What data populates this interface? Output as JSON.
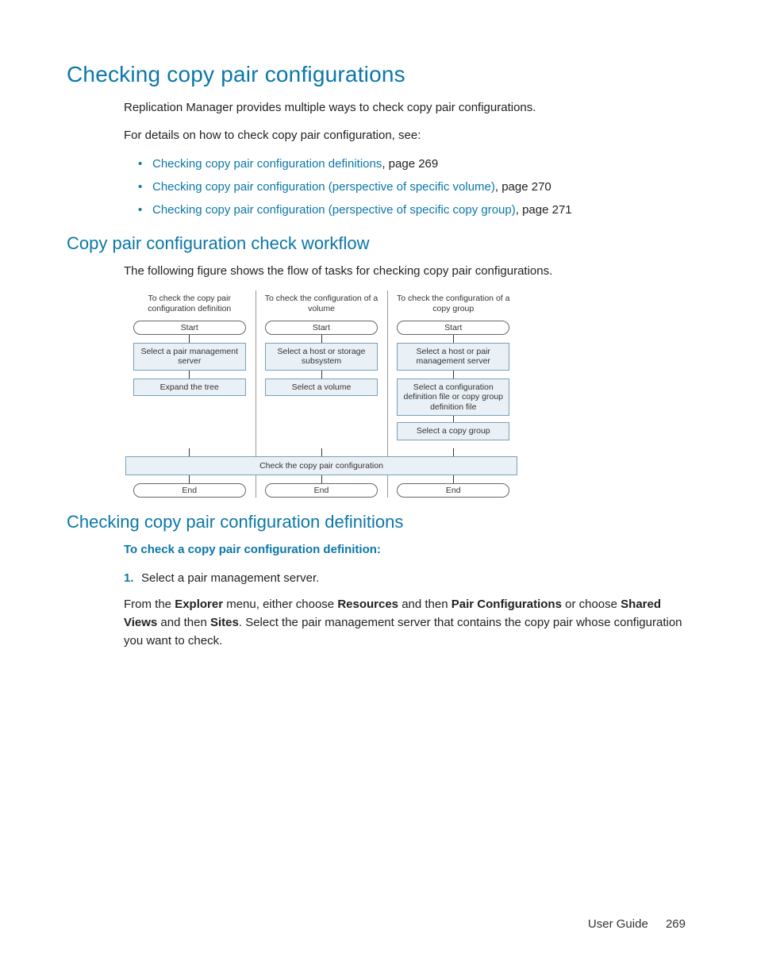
{
  "heading": "Checking copy pair configurations",
  "intro1": "Replication Manager provides multiple ways to check copy pair configurations.",
  "intro2": "For details on how to check copy pair configuration, see:",
  "bullets": [
    {
      "link": "Checking copy pair configuration definitions",
      "tail": ", page 269"
    },
    {
      "link": "Checking copy pair configuration (perspective of specific volume)",
      "tail": ", page 270"
    },
    {
      "link": "Checking copy pair configuration (perspective of specific copy group)",
      "tail": ", page 271"
    }
  ],
  "sub1": "Copy pair configuration check workflow",
  "sub1_text": "The following figure shows the flow of tasks for checking copy pair configurations.",
  "flow": {
    "col_heads": [
      "To check the copy pair configuration definition",
      "To check the configuration of a volume",
      "To check the configuration of a copy group"
    ],
    "start": "Start",
    "end": "End",
    "c1_step1": "Select a pair management server",
    "c1_step2": "Expand the tree",
    "c2_step1": "Select a host or storage subsystem",
    "c2_step2": "Select a volume",
    "c3_step1": "Select a host or pair management server",
    "c3_step2": "Select a configuration definition file or copy group definition file",
    "c3_step3": "Select a copy group",
    "merge": "Check the copy pair configuration"
  },
  "sub2": "Checking copy pair configuration definitions",
  "sub2_bold": "To check a copy pair configuration definition:",
  "step_num": "1.",
  "step1_text": "Select a pair management server.",
  "step1_cont_a": "From the ",
  "step1_cont_b": "Explorer",
  "step1_cont_c": " menu, either choose ",
  "step1_cont_d": "Resources",
  "step1_cont_e": " and then ",
  "step1_cont_f": "Pair Configurations",
  "step1_cont_g": " or choose ",
  "step1_cont_h": "Shared Views",
  "step1_cont_i": " and then ",
  "step1_cont_j": "Sites",
  "step1_cont_k": ". Select the pair management server that contains the copy pair whose configuration you want to check.",
  "footer_label": "User Guide",
  "footer_page": "269"
}
